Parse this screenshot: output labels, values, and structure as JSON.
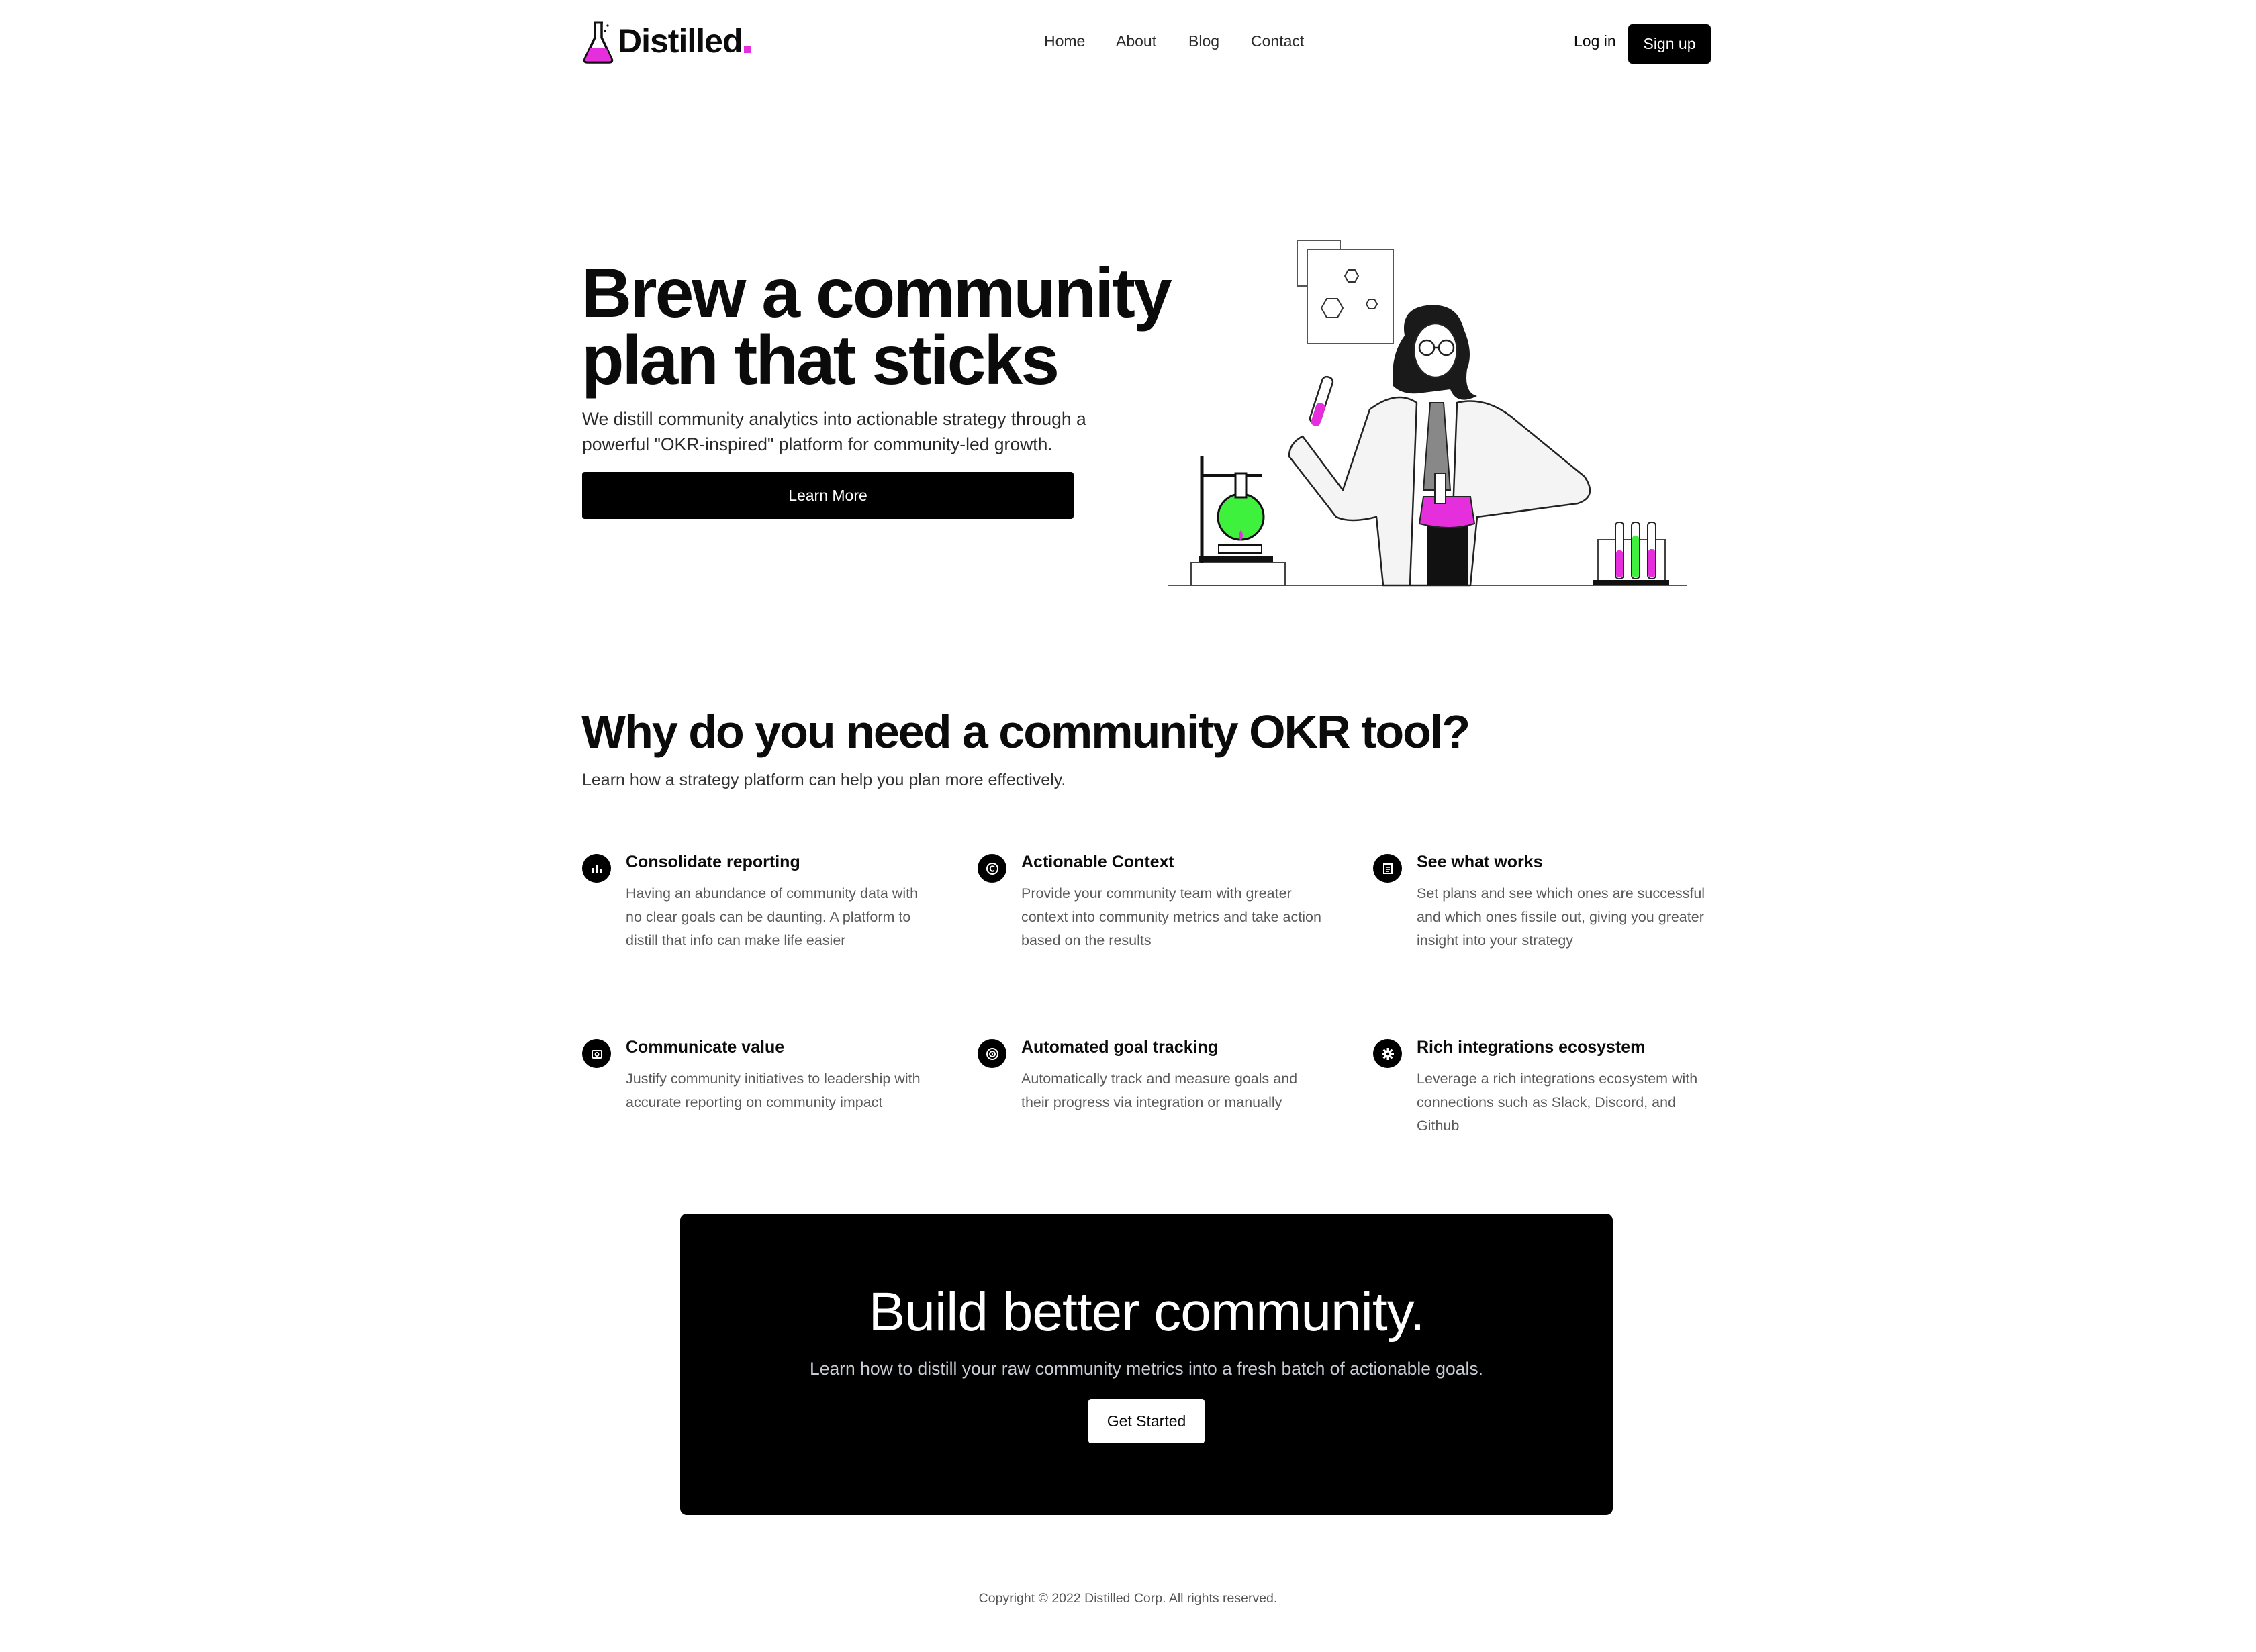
{
  "brand": {
    "name": "Distilled",
    "accent": "#e52fdc",
    "green": "#3df13d",
    "icon": "flask-icon"
  },
  "nav": {
    "links": [
      "Home",
      "About",
      "Blog",
      "Contact"
    ],
    "login": "Log in",
    "signup": "Sign up"
  },
  "hero": {
    "title_line1": "Brew a community",
    "title_line2": "plan that sticks",
    "subtitle": "We distill community analytics into actionable strategy through a powerful \"OKR-inspired\" platform for community-led growth.",
    "cta": "Learn More",
    "illustration": "scientist-lab-illustration"
  },
  "why": {
    "title": "Why do you need a community OKR tool?",
    "subtitle": "Learn how a strategy platform can help you plan more effectively.",
    "features": [
      {
        "icon": "bar-chart-icon",
        "title": "Consolidate reporting",
        "text": "Having an abundance of community data with no clear goals can be daunting. A platform to distill that info can make life easier"
      },
      {
        "icon": "copyright-icon",
        "title": "Actionable Context",
        "text": "Provide your community team with greater context into community metrics and take action based on the results"
      },
      {
        "icon": "document-icon",
        "title": "See what works",
        "text": "Set plans and see which ones are successful and which ones fissile out, giving you greater insight into your strategy"
      },
      {
        "icon": "camera-icon",
        "title": "Communicate value",
        "text": "Justify community initiatives to leadership with accurate reporting on community impact"
      },
      {
        "icon": "target-icon",
        "title": "Automated goal tracking",
        "text": "Automatically track and measure goals and their progress via integration or manually"
      },
      {
        "icon": "gear-icon",
        "title": "Rich integrations ecosystem",
        "text": "Leverage a rich integrations ecosystem with connections such as Slack, Discord, and Github"
      }
    ]
  },
  "cta": {
    "title": "Build better community.",
    "subtitle": "Learn how to distill your raw community metrics into a fresh batch of actionable goals.",
    "button": "Get Started"
  },
  "footer": {
    "copyright": "Copyright © 2022 Distilled Corp. All rights reserved."
  }
}
